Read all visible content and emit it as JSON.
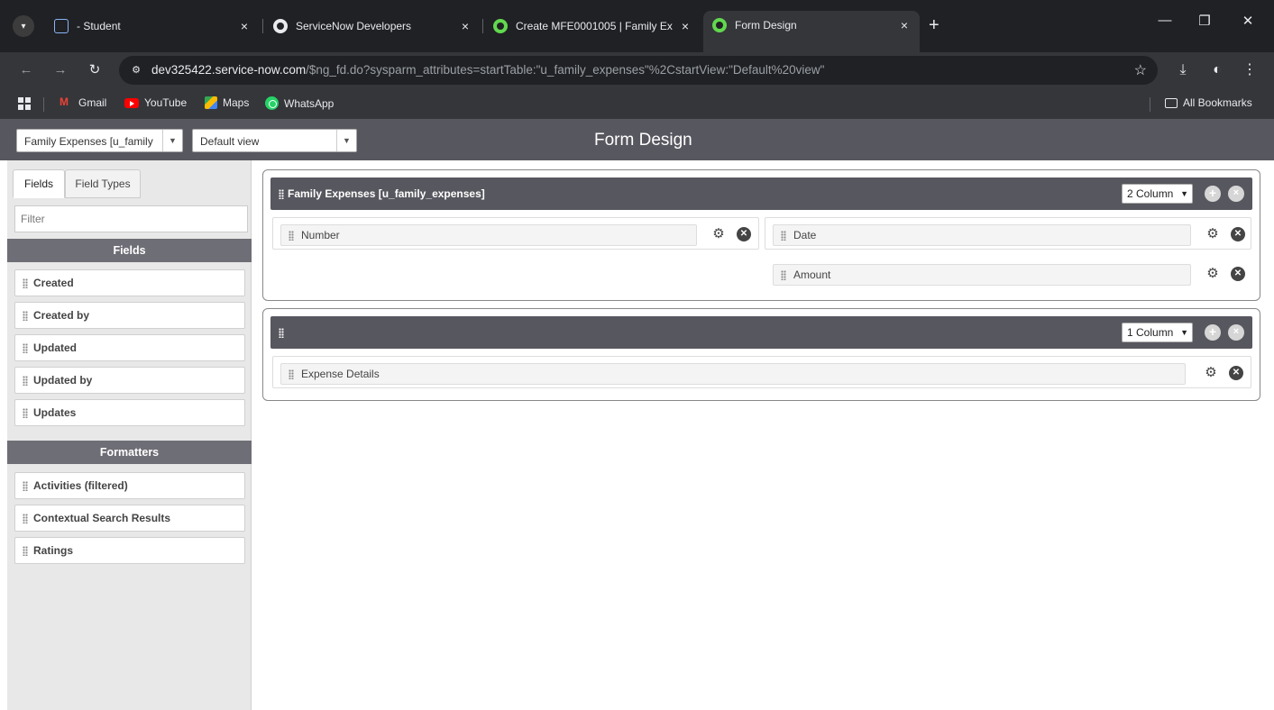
{
  "browser": {
    "tabs": [
      {
        "title": "- Student",
        "close": "×"
      },
      {
        "title": "ServiceNow Developers",
        "close": "×"
      },
      {
        "title": "Create MFE0001005 | Family Ex",
        "close": "×"
      },
      {
        "title": "Form Design",
        "close": "×"
      }
    ],
    "new_tab": "+",
    "url_host": "dev325422.service-now.com",
    "url_path": "/$ng_fd.do?sysparm_attributes=startTable:\"u_family_expenses\"%2CstartView:\"Default%20view\"",
    "bookmarks": {
      "gmail": "Gmail",
      "youtube": "YouTube",
      "maps": "Maps",
      "whatsapp": "WhatsApp",
      "all": "All Bookmarks"
    }
  },
  "header": {
    "table_select": "Family Expenses [u_family",
    "view_select": "Default view",
    "title": "Form Design"
  },
  "left_panel": {
    "tabs": {
      "fields": "Fields",
      "field_types": "Field Types"
    },
    "filter_placeholder": "Filter",
    "fields_heading": "Fields",
    "fields": [
      "Created",
      "Created by",
      "Updated",
      "Updated by",
      "Updates"
    ],
    "formatters_heading": "Formatters",
    "formatters": [
      "Activities (filtered)",
      "Contextual Search Results",
      "Ratings"
    ]
  },
  "sections": [
    {
      "title": "Family Expenses [u_family_expenses]",
      "columns_label": "2 Column",
      "left_fields": [
        "Number"
      ],
      "right_fields": [
        "Date",
        "Amount"
      ]
    },
    {
      "title": "",
      "columns_label": "1 Column",
      "fields": [
        "Expense Details"
      ]
    }
  ]
}
